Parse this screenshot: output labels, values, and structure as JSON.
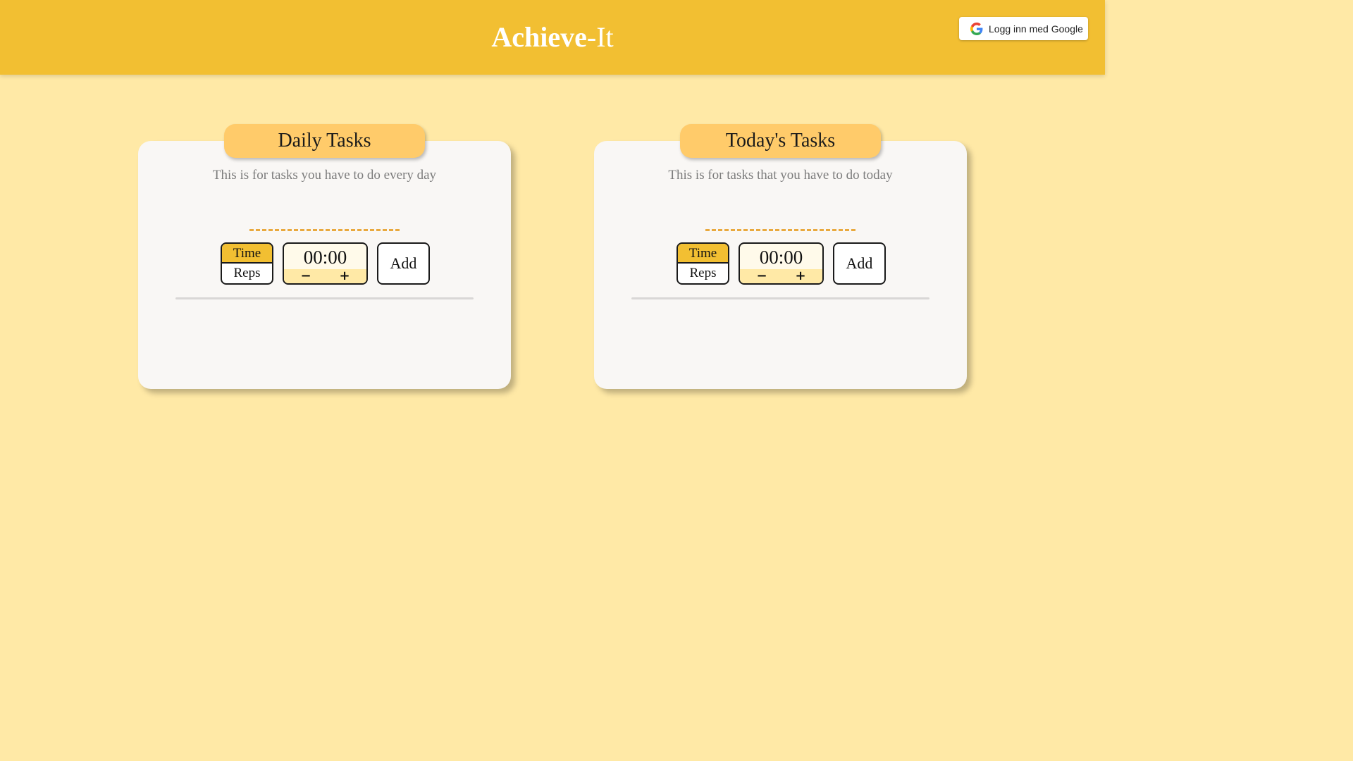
{
  "header": {
    "title_bold": "Achieve",
    "title_light": "-It",
    "login_button": {
      "label": "Logg inn med Google",
      "icon": "google-icon"
    }
  },
  "colors": {
    "header_bg": "#F2BF32",
    "page_bg": "#FFE9A6",
    "panel_bg": "#F9F7F5",
    "tab_bg": "#FFCB6A",
    "dash_accent": "#E9A93E"
  },
  "panels": [
    {
      "title": "Daily Tasks",
      "description": "This is for tasks you have to do every day",
      "mode_options": [
        "Time",
        "Reps"
      ],
      "selected_mode": "Time",
      "timer_value": "00:00",
      "decrement_symbol": "−",
      "increment_symbol": "+",
      "add_label": "Add"
    },
    {
      "title": "Today's Tasks",
      "description": "This is for tasks that you have to do today",
      "mode_options": [
        "Time",
        "Reps"
      ],
      "selected_mode": "Time",
      "timer_value": "00:00",
      "decrement_symbol": "−",
      "increment_symbol": "+",
      "add_label": "Add"
    }
  ]
}
